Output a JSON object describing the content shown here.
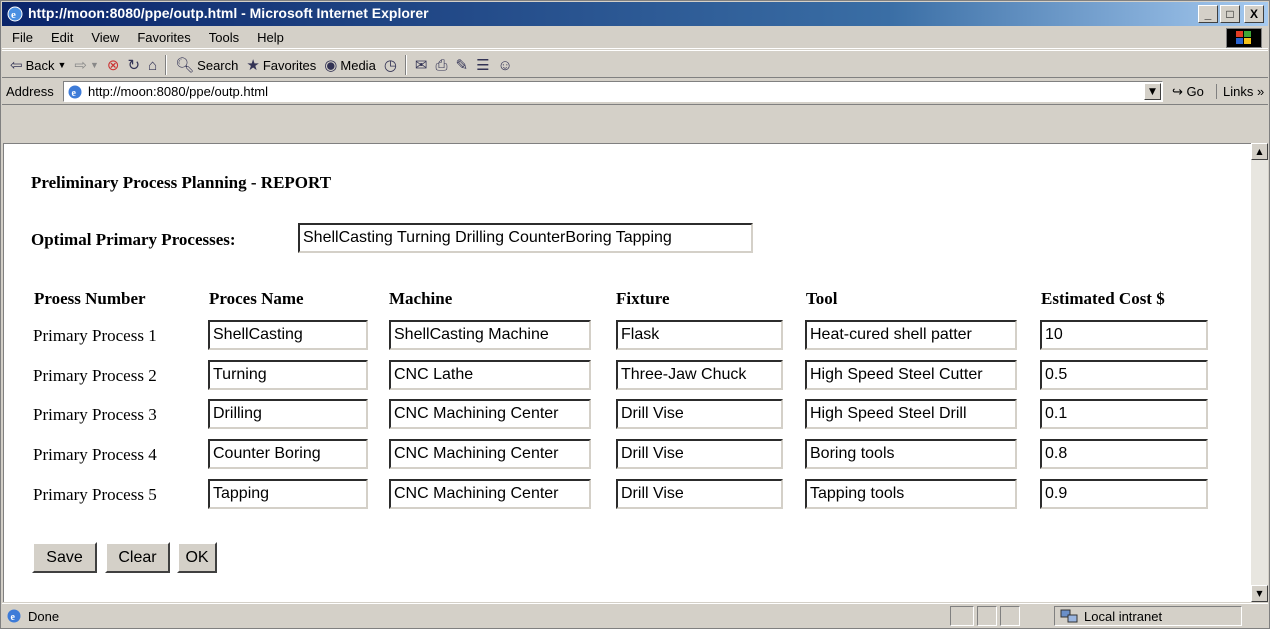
{
  "window": {
    "title": "http://moon:8080/ppe/outp.html - Microsoft Internet Explorer",
    "buttons": {
      "minimize": "_",
      "maximize": "□",
      "close": "X"
    }
  },
  "menu": [
    "File",
    "Edit",
    "View",
    "Favorites",
    "Tools",
    "Help"
  ],
  "toolbar": {
    "back": "Back",
    "search": "Search",
    "favorites": "Favorites",
    "media": "Media"
  },
  "address": {
    "label": "Address",
    "url": "http://moon:8080/ppe/outp.html",
    "go": "Go",
    "links": "Links"
  },
  "report": {
    "title": "Preliminary Process Planning - REPORT",
    "optimal_label": "Optimal Primary Processes:",
    "optimal_value": "ShellCasting Turning Drilling CounterBoring Tapping",
    "columns": [
      "Proess Number",
      "Proces Name",
      "Machine",
      "Fixture",
      "Tool",
      "Estimated Cost $"
    ],
    "rows": [
      {
        "label": "Primary Process 1",
        "name": "ShellCasting",
        "machine": "ShellCasting Machine",
        "fixture": "Flask",
        "tool": "Heat-cured shell patter",
        "cost": "10"
      },
      {
        "label": "Primary Process 2",
        "name": "Turning",
        "machine": "CNC Lathe",
        "fixture": "Three-Jaw Chuck",
        "tool": "High Speed Steel Cutter",
        "cost": "0.5"
      },
      {
        "label": "Primary Process 3",
        "name": "Drilling",
        "machine": "CNC Machining Center",
        "fixture": "Drill Vise",
        "tool": "High Speed Steel Drill",
        "cost": "0.1"
      },
      {
        "label": "Primary Process 4",
        "name": "Counter Boring",
        "machine": "CNC Machining Center",
        "fixture": "Drill Vise",
        "tool": "Boring tools",
        "cost": "0.8"
      },
      {
        "label": "Primary Process 5",
        "name": "Tapping",
        "machine": "CNC Machining Center",
        "fixture": "Drill Vise",
        "tool": "Tapping tools",
        "cost": "0.9"
      }
    ],
    "buttons": {
      "save": "Save",
      "clear": "Clear",
      "ok": "OK"
    }
  },
  "status": {
    "text": "Done",
    "zone": "Local intranet"
  }
}
